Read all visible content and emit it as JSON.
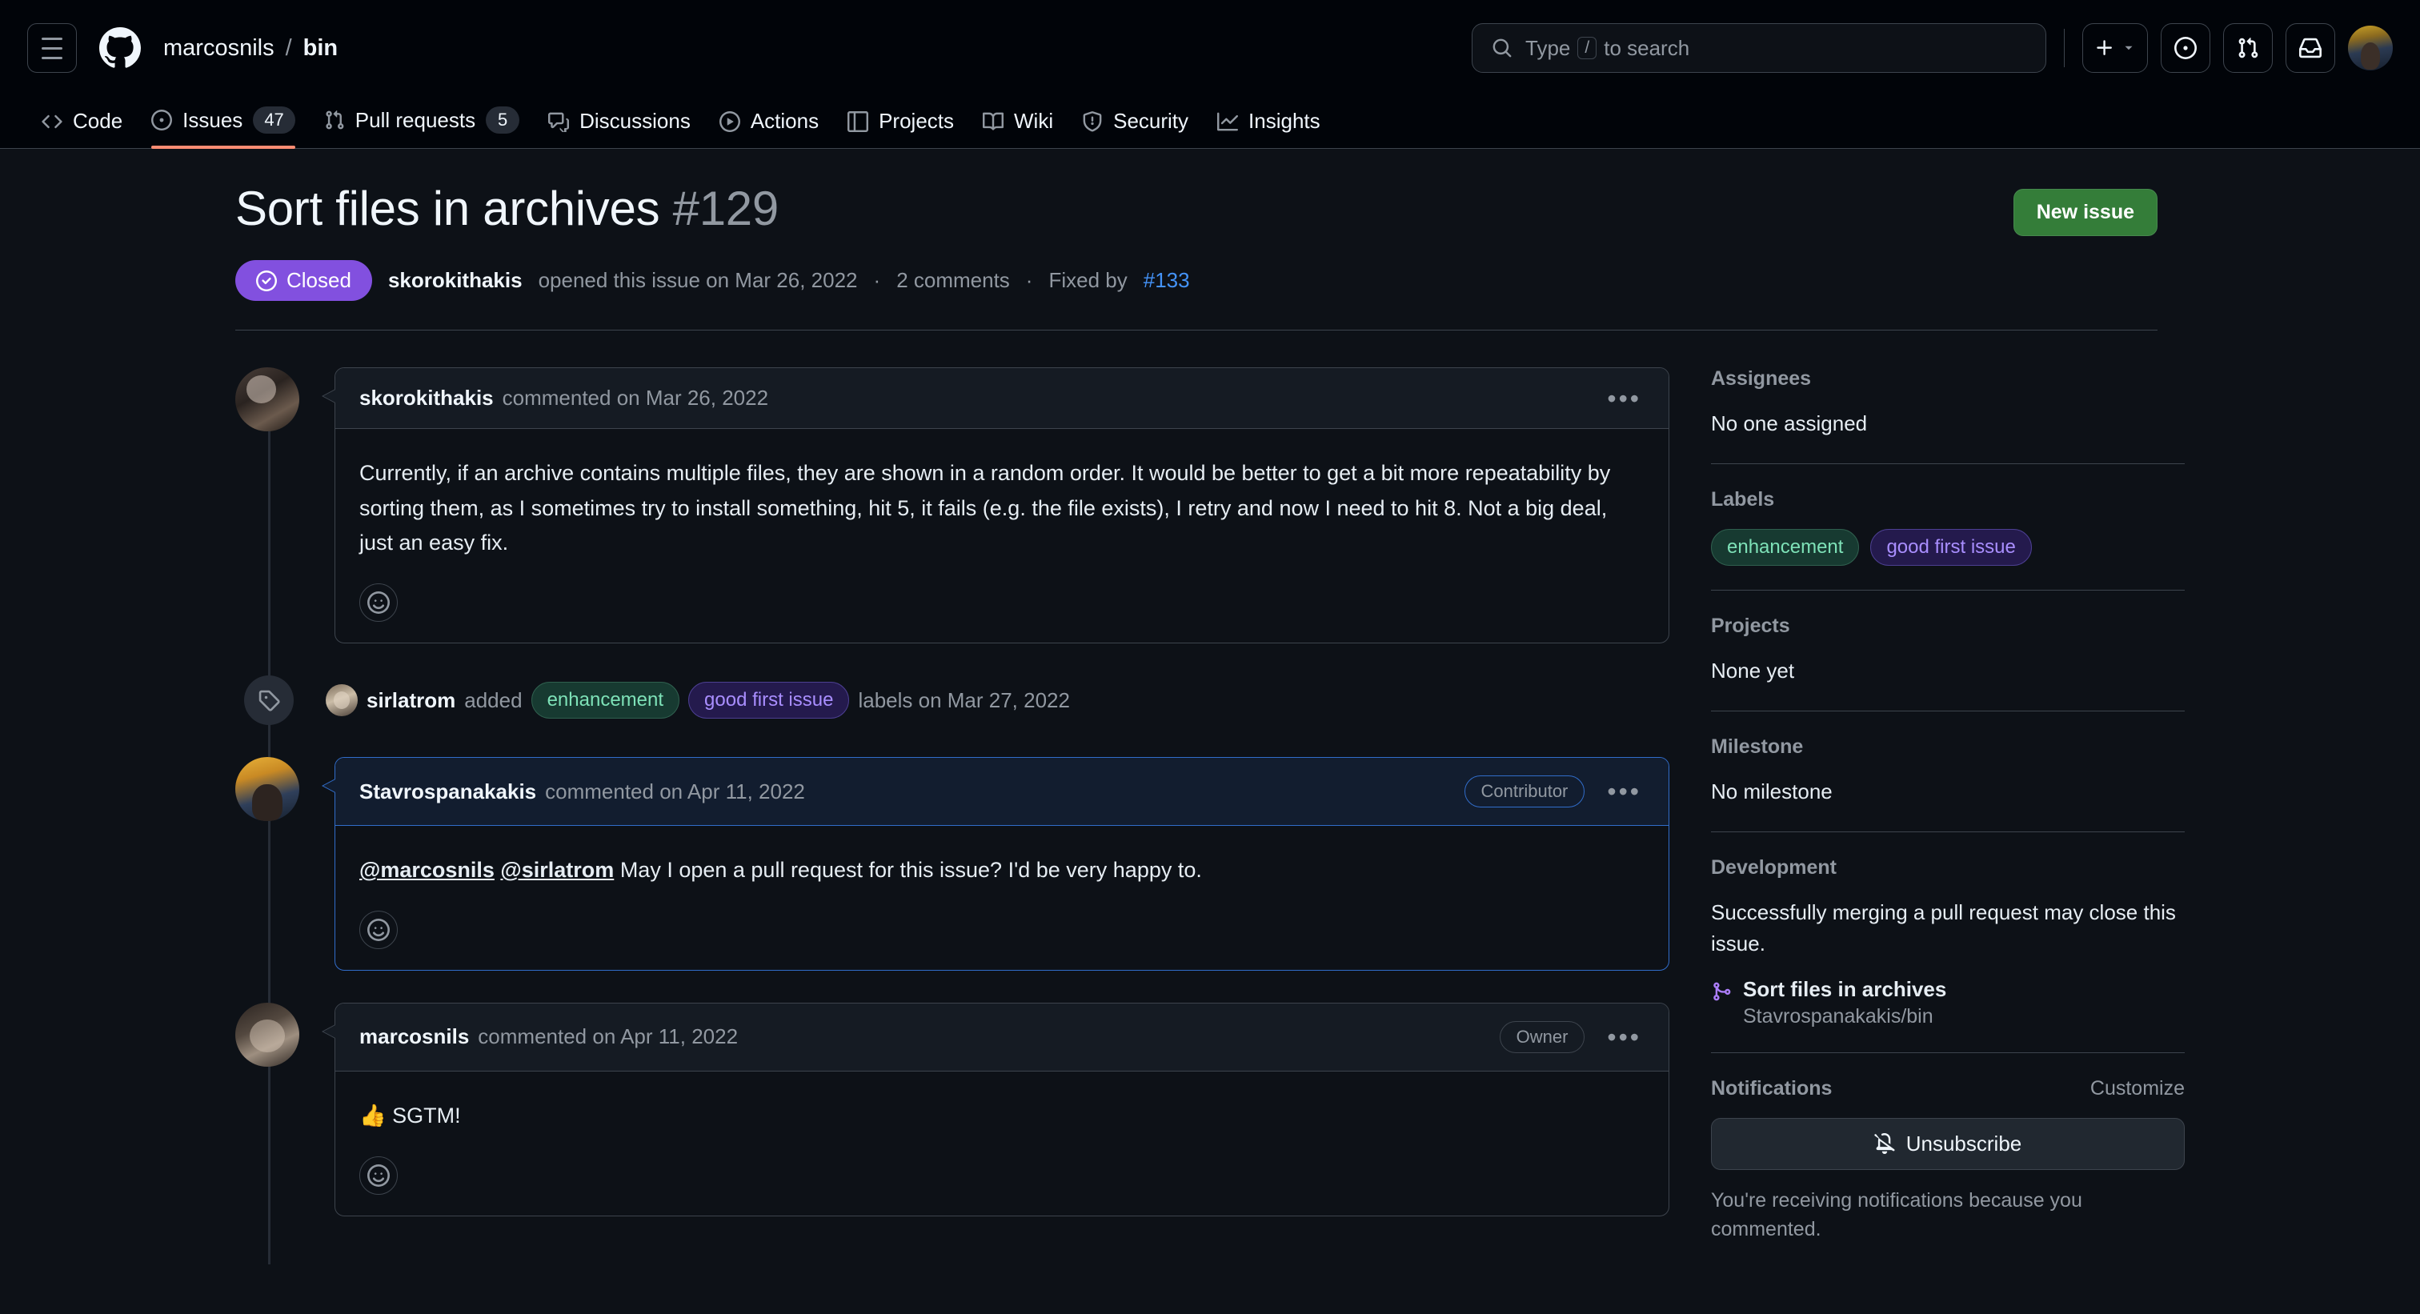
{
  "header": {
    "menu_icon": "hamburger-icon",
    "logo_icon": "github-logo-icon",
    "owner": "marcosnils",
    "separator": "/",
    "repo": "bin",
    "search_placeholder_pre": "Type",
    "search_slash_key": "/",
    "search_placeholder_post": "to search",
    "create_new_icon": "plus-icon",
    "create_new_caret": "chevron-down-icon",
    "issues_icon": "issue-opened-icon",
    "pulls_icon": "git-pull-request-icon",
    "inbox_icon": "inbox-icon",
    "avatar": "user-avatar"
  },
  "repo_nav": [
    {
      "label": "Code",
      "icon": "code-icon",
      "count": null,
      "active": false
    },
    {
      "label": "Issues",
      "icon": "issue-opened-icon",
      "count": "47",
      "active": true
    },
    {
      "label": "Pull requests",
      "icon": "git-pull-request-icon",
      "count": "5",
      "active": false
    },
    {
      "label": "Discussions",
      "icon": "comment-discussion-icon",
      "count": null,
      "active": false
    },
    {
      "label": "Actions",
      "icon": "play-icon",
      "count": null,
      "active": false
    },
    {
      "label": "Projects",
      "icon": "table-icon",
      "count": null,
      "active": false
    },
    {
      "label": "Wiki",
      "icon": "book-icon",
      "count": null,
      "active": false
    },
    {
      "label": "Security",
      "icon": "shield-icon",
      "count": null,
      "active": false
    },
    {
      "label": "Insights",
      "icon": "graph-icon",
      "count": null,
      "active": false
    }
  ],
  "issue": {
    "title": "Sort files in archives",
    "number": "#129",
    "new_issue_label": "New issue",
    "state": "Closed",
    "state_icon": "issue-closed-icon",
    "state_color": "#8250df",
    "opened_by": "skorokithakis",
    "opened_text": "opened this issue on Mar 26, 2022",
    "dot1": "·",
    "comments_text": "2 comments",
    "dot2": "·",
    "fixed_by_text": "Fixed by",
    "fixed_by_link": "#133"
  },
  "timeline": [
    {
      "kind": "comment",
      "avatar_class": "av-skoro",
      "author": "skorokithakis",
      "meta": "commented on Mar 26, 2022",
      "role": null,
      "highlight": false,
      "body": "Currently, if an archive contains multiple files, they are shown in a random order. It would be better to get a bit more repeatability by sorting them, as I sometimes try to install something, hit 5, it fails (e.g. the file exists), I retry and now I need to hit 8. Not a big deal, just an easy fix.",
      "mentions": [],
      "reaction_icon": "smiley-icon",
      "kebab_icon": "kebab-horizontal-icon"
    },
    {
      "kind": "event",
      "icon": "tag-icon",
      "avatar_class": "av-sirl",
      "actor": "sirlatrom",
      "verb": "added",
      "labels": [
        "enhancement",
        "good first issue"
      ],
      "suffix": "labels on Mar 27, 2022"
    },
    {
      "kind": "comment",
      "avatar_class": "av-stav",
      "author": "Stavrospanakakis",
      "meta": "commented on Apr 11, 2022",
      "role": "Contributor",
      "highlight": true,
      "body_mentions": [
        "@marcosnils",
        "@sirlatrom"
      ],
      "body": "May I open a pull request for this issue? I'd be very happy to.",
      "reaction_icon": "smiley-icon",
      "kebab_icon": "kebab-horizontal-icon"
    },
    {
      "kind": "comment",
      "avatar_class": "av-marcos",
      "author": "marcosnils",
      "meta": "commented on Apr 11, 2022",
      "role": "Owner",
      "highlight": false,
      "body": "👍 SGTM!",
      "mentions": [],
      "reaction_icon": "smiley-icon",
      "kebab_icon": "kebab-horizontal-icon"
    }
  ],
  "sidebar": {
    "assignees": {
      "heading": "Assignees",
      "value": "No one assigned"
    },
    "labels": {
      "heading": "Labels",
      "items": [
        {
          "name": "enhancement",
          "class": "lbl-enh",
          "color": "#7ee2b8"
        },
        {
          "name": "good first issue",
          "class": "lbl-gfi",
          "color": "#a98eff"
        }
      ]
    },
    "projects": {
      "heading": "Projects",
      "value": "None yet"
    },
    "milestone": {
      "heading": "Milestone",
      "value": "No milestone"
    },
    "development": {
      "heading": "Development",
      "description": "Successfully merging a pull request may close this issue.",
      "pr_icon": "git-pull-request-merged-icon",
      "pr_title": "Sort files in archives",
      "pr_repo": "Stavrospanakakis/bin"
    },
    "notifications": {
      "heading": "Notifications",
      "customize_label": "Customize",
      "button_label": "Unsubscribe",
      "button_icon": "bell-slash-icon",
      "note": "You're receiving notifications because you commented."
    }
  }
}
